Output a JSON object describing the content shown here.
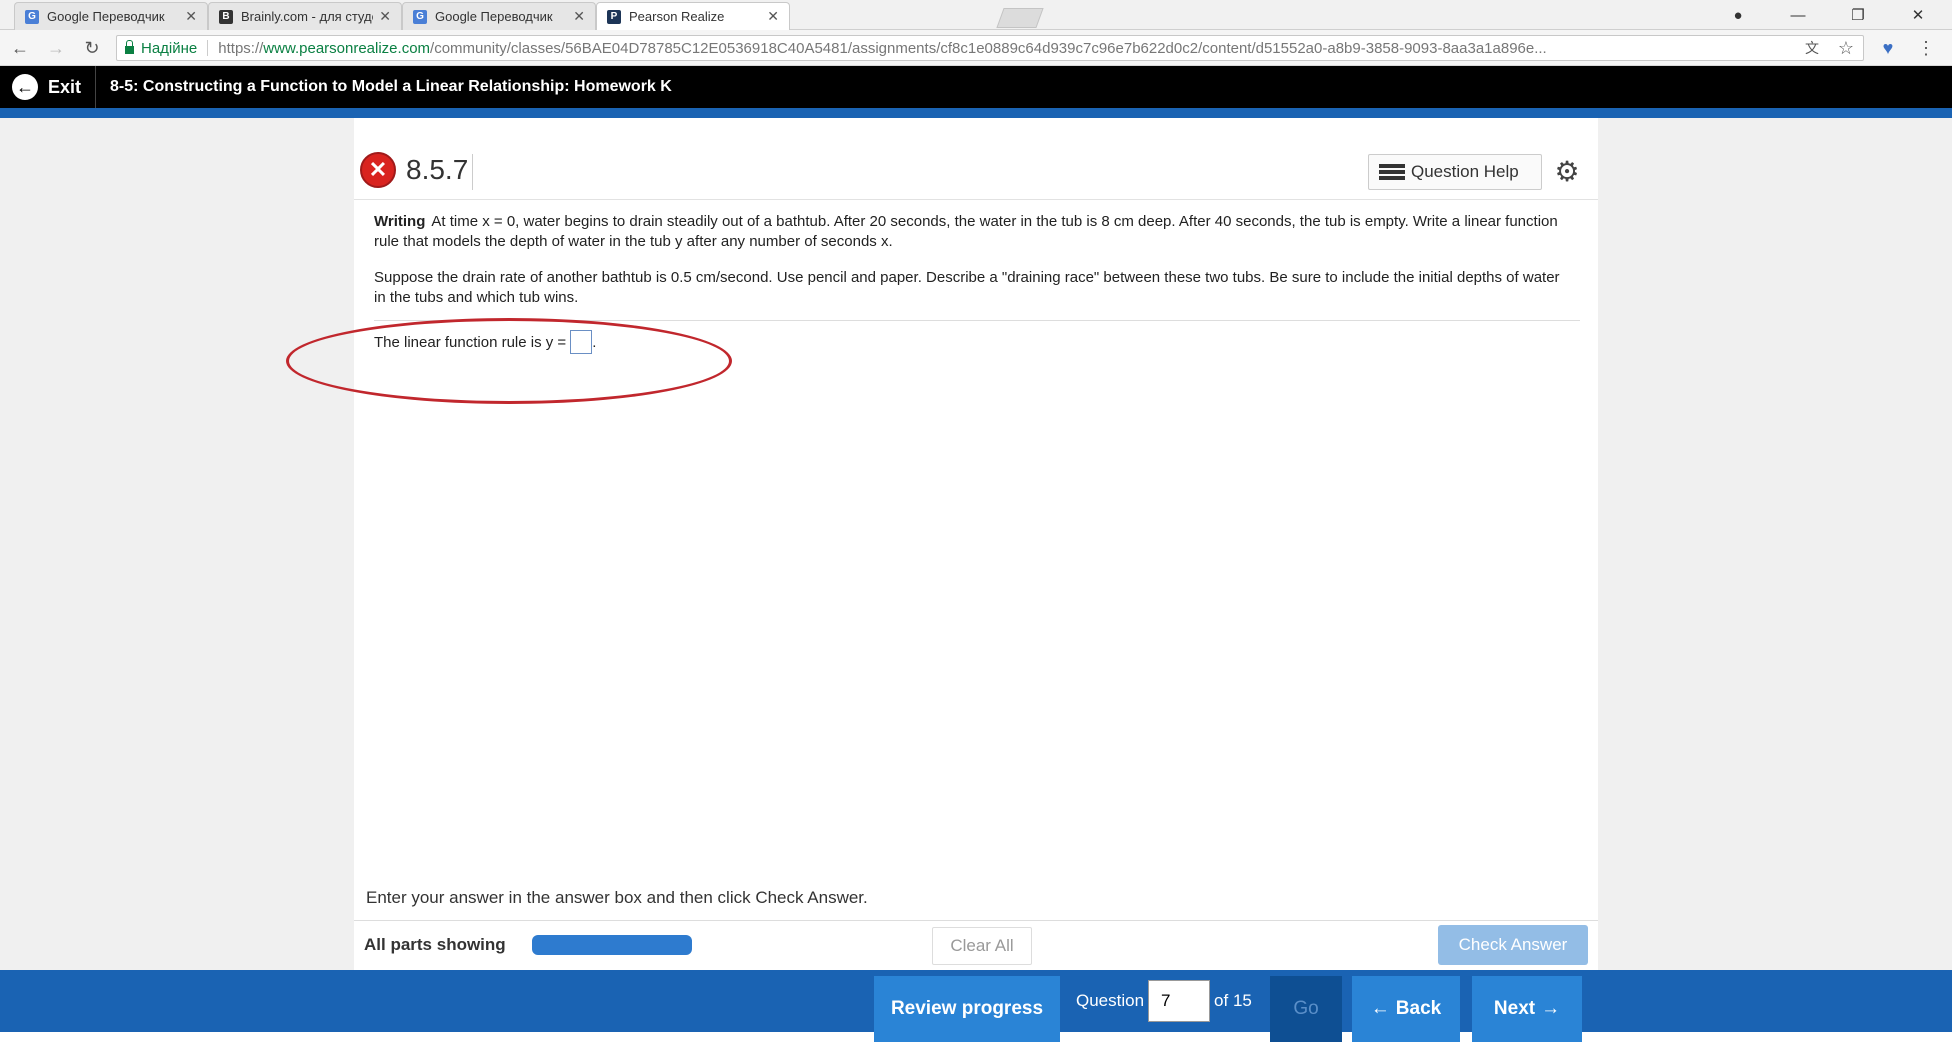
{
  "browser": {
    "tabs": [
      {
        "title": "Google Переводчик",
        "favicon": "G",
        "color": "#4a7fd6"
      },
      {
        "title": "Brainly.com - для студен",
        "favicon": "B",
        "color": "#333333"
      },
      {
        "title": "Google Переводчик",
        "favicon": "G",
        "color": "#4a7fd6"
      },
      {
        "title": "Pearson Realize",
        "favicon": "P",
        "color": "#1d3557",
        "active": true
      }
    ],
    "secure_label": "Надійне",
    "url_scheme": "https://",
    "url_host": "www.pearsonrealize.com",
    "url_path": "/community/classes/56BAE04D78785C12E0536918C40A5481/assignments/cf8c1e0889c64d939c7c96e7b622d0c2/content/d51552a0-a8b9-3858-9093-8aa3a1a896e..."
  },
  "header": {
    "exit_label": "Exit",
    "title": "8-5: Constructing a Function to Model a Linear Relationship: Homework K"
  },
  "question": {
    "number": "8.5.7",
    "help_label": "Question Help",
    "writing_label": "Writing",
    "paragraph1": "At time x = 0, water begins to drain steadily out of a bathtub. After 20 seconds, the water in the tub is 8 cm deep. After 40 seconds, the tub is empty. Write a linear function rule that models the depth of water in the tub y after any number of seconds x.",
    "paragraph2": "Suppose the drain rate of another bathtub is 0.5 cm/second. Use pencil and paper. Describe a \"draining race\" between these two tubs. Be sure to include the initial depths of water in the tubs and which tub wins.",
    "answer_prompt": "The linear function rule is y =",
    "answer_suffix": ".",
    "instruction": "Enter your answer in the answer box and then click Check Answer.",
    "all_parts_label": "All parts showing",
    "clear_all_label": "Clear All",
    "check_answer_label": "Check Answer"
  },
  "bottom_nav": {
    "review_label": "Review progress",
    "question_label": "Question",
    "current_question": "7",
    "of_total": "of 15",
    "go_label": "Go",
    "back_label": "Back",
    "next_label": "Next"
  },
  "colors": {
    "brand_blue": "#1a63b3",
    "button_blue": "#2a84d6",
    "error_red": "#d9231f",
    "annotation_red": "#c1272d"
  }
}
